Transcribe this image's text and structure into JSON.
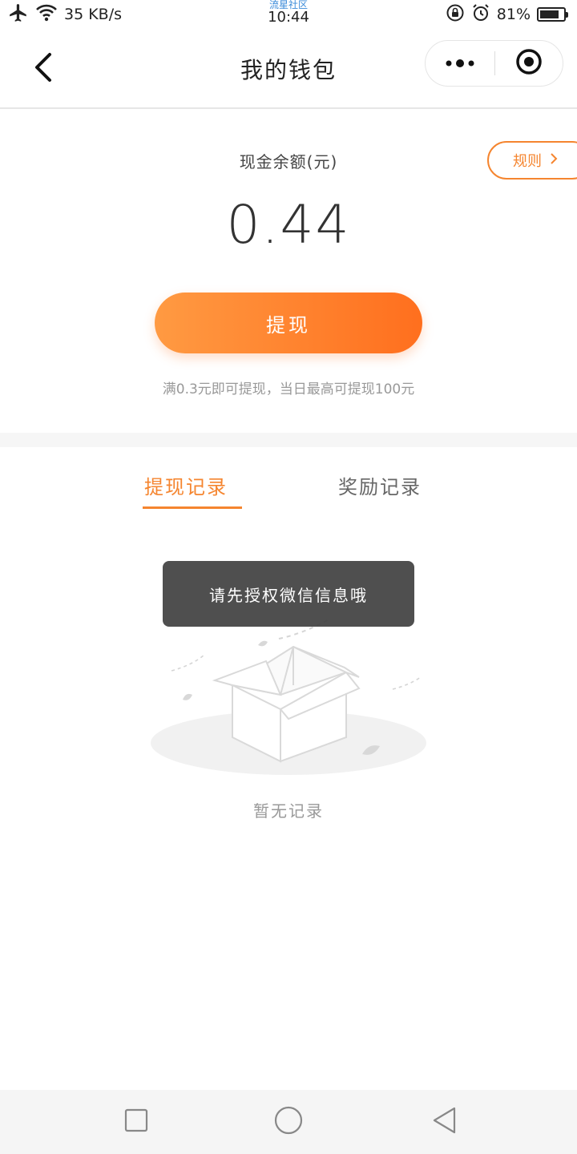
{
  "status_bar": {
    "network_speed": "35 KB/s",
    "time": "10:44",
    "watermark": "流星社区",
    "battery_percent": "81%",
    "battery_level": 0.81,
    "icons": [
      "airplane-icon",
      "wifi-icon",
      "rotation-lock-icon",
      "alarm-icon",
      "battery-icon"
    ]
  },
  "nav": {
    "title": "我的钱包",
    "icons": [
      "back-chevron-icon",
      "more-dots-icon",
      "target-close-icon"
    ]
  },
  "balance": {
    "label": "现金余额(元)",
    "amount": "0.44",
    "rules_label": "规则",
    "withdraw_label": "提现",
    "note": "满0.3元即可提现，当日最高可提现100元"
  },
  "tabs": [
    {
      "label": "提现记录",
      "active": true
    },
    {
      "label": "奖励记录",
      "active": false
    }
  ],
  "empty_state": {
    "text": "暂无记录",
    "icon": "empty-box-illustration"
  },
  "toast": {
    "text": "请先授权微信信息哦"
  },
  "colors": {
    "accent": "#f5852f",
    "button_gradient_start": "#ff9a42",
    "button_gradient_end": "#ff6f1e"
  },
  "android_nav": {
    "icons": [
      "recent-apps-icon",
      "home-icon",
      "back-triangle-icon"
    ]
  }
}
